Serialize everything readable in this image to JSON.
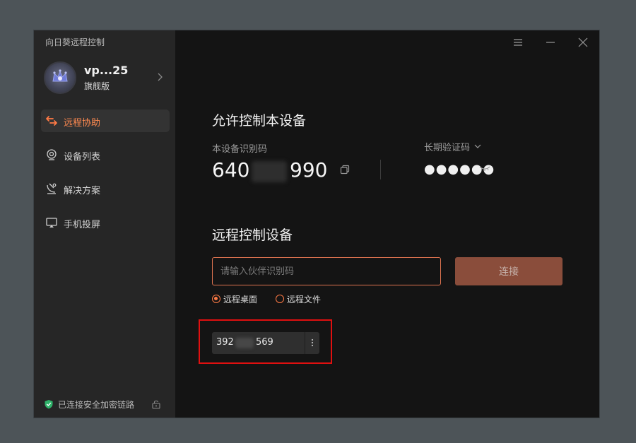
{
  "app": {
    "title": "向日葵远程控制"
  },
  "profile": {
    "name": "vp...25",
    "level": "旗舰版"
  },
  "nav": [
    {
      "label": "远程协助",
      "icon": "remote-assist-icon",
      "active": true
    },
    {
      "label": "设备列表",
      "icon": "device-list-icon",
      "active": false
    },
    {
      "label": "解决方案",
      "icon": "solution-icon",
      "active": false
    },
    {
      "label": "手机投屏",
      "icon": "screen-cast-icon",
      "active": false
    }
  ],
  "footer": {
    "secure_text": "已连接安全加密链路"
  },
  "allow_section": {
    "title": "允许控制本设备",
    "device_id_label": "本设备识别码",
    "device_id_prefix": "640",
    "device_id_suffix": "990",
    "code_label": "长期验证码",
    "code_value": "●●●●●●"
  },
  "remote_section": {
    "title": "远程控制设备",
    "input_placeholder": "请输入伙伴识别码",
    "connect_label": "连接",
    "modes": [
      {
        "label": "远程桌面",
        "selected": true
      },
      {
        "label": "远程文件",
        "selected": false
      }
    ]
  },
  "recent": {
    "id_prefix": "392",
    "id_suffix": "569"
  },
  "colors": {
    "accent": "#ff7a45",
    "connect_bg": "#8a4d3b",
    "sidebar_bg": "#262626",
    "main_bg": "#141414",
    "highlight": "#e01010"
  }
}
